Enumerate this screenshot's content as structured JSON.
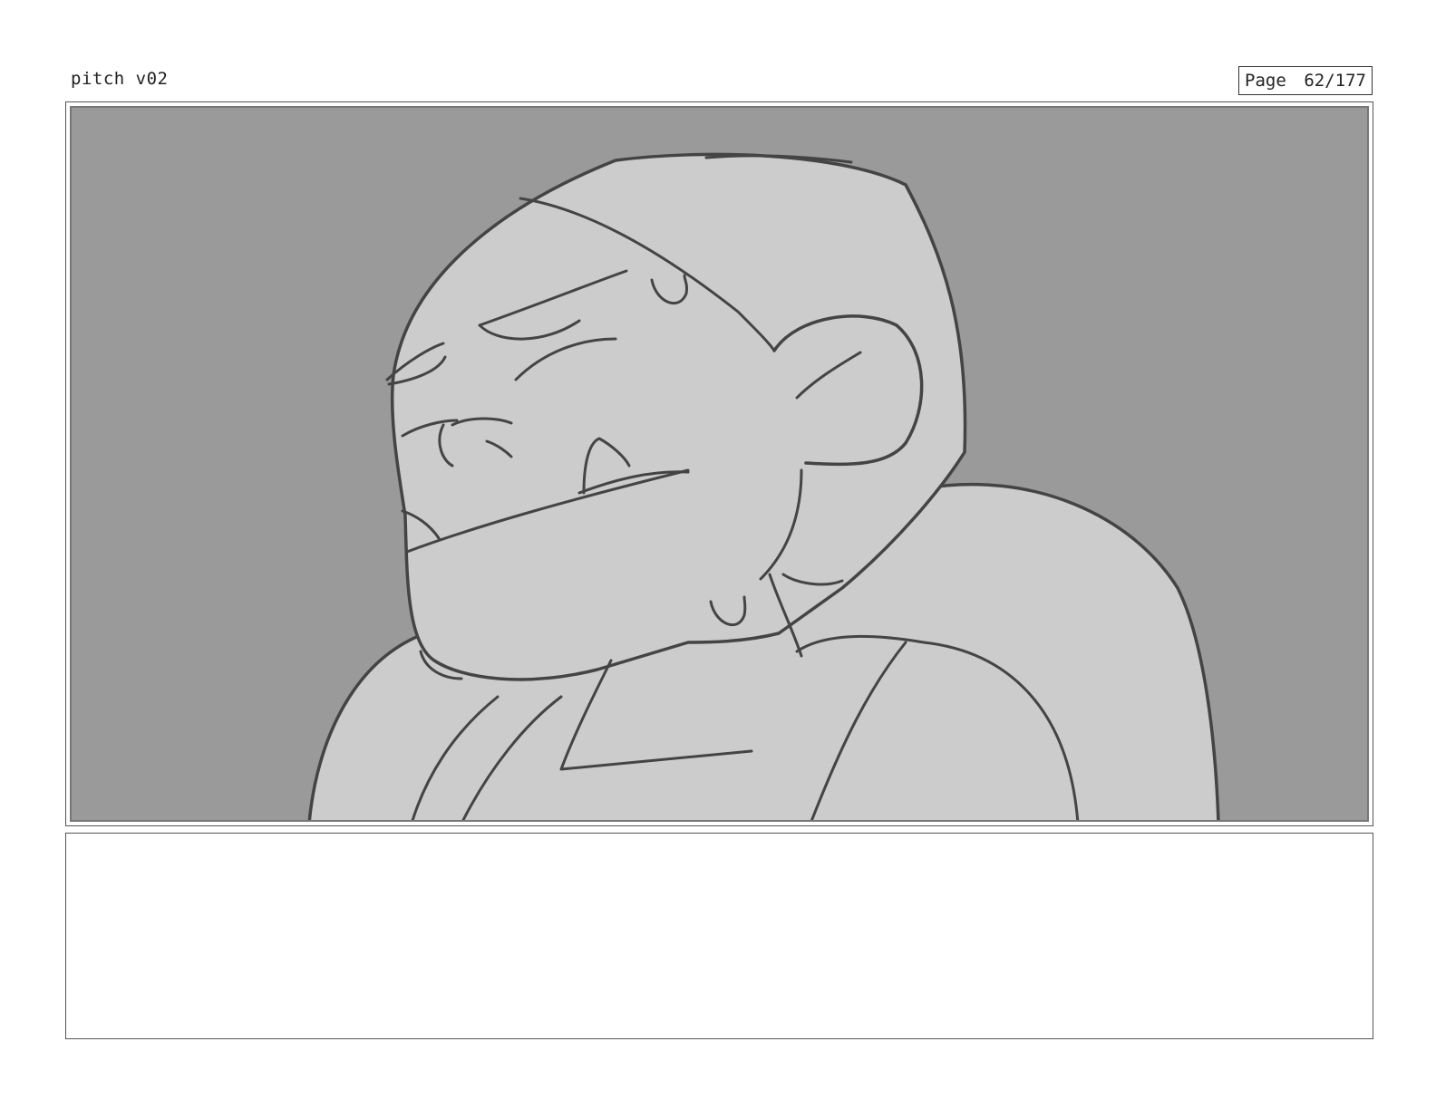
{
  "header": {
    "title": "pitch v02",
    "page_label": "Page",
    "page_number": "62/177"
  },
  "panel": {
    "description_icon": "storyboard-sketch-character-head",
    "background_color": "#9a9a9a",
    "fill_color": "#cccccc",
    "line_color": "#444444"
  },
  "notes": {
    "text": ""
  }
}
